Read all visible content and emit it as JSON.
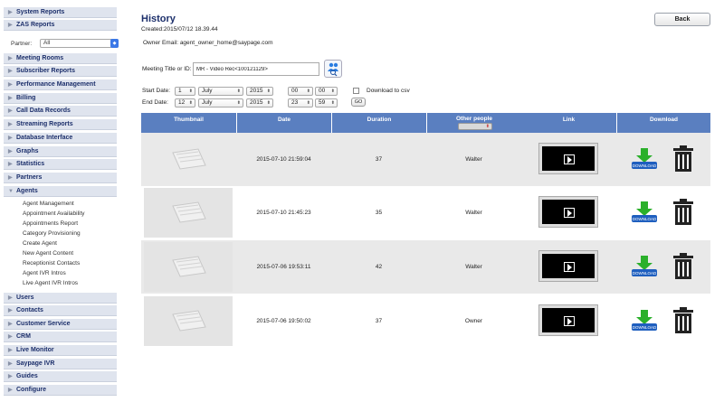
{
  "sidebar": {
    "partner_label": "Partner:",
    "partner_value": "All",
    "items": [
      {
        "label": "System Reports"
      },
      {
        "label": "ZAS Reports"
      },
      {
        "label": "Meeting Rooms"
      },
      {
        "label": "Subscriber Reports"
      },
      {
        "label": "Performance Management"
      },
      {
        "label": "Billing"
      },
      {
        "label": "Call Data Records"
      },
      {
        "label": "Streaming Reports"
      },
      {
        "label": "Database Interface"
      },
      {
        "label": "Graphs"
      },
      {
        "label": "Statistics"
      },
      {
        "label": "Partners"
      },
      {
        "label": "Agents"
      },
      {
        "label": "Users"
      },
      {
        "label": "Contacts"
      },
      {
        "label": "Customer Service"
      },
      {
        "label": "CRM"
      },
      {
        "label": "Live Monitor"
      },
      {
        "label": "Saypage IVR"
      },
      {
        "label": "Guides"
      },
      {
        "label": "Configure"
      }
    ],
    "agents_sub": [
      "Agent Management",
      "Appointment Availability",
      "Appointments Report",
      "Category Provisioning",
      "Create Agent",
      "New Agent Content",
      "Receptionist Contacts",
      "Agent IVR Intros",
      "Live Agent IVR Intros"
    ]
  },
  "header": {
    "title": "History",
    "created": "Created:2015/07/12 18.39.44",
    "owner_email": "Owner Email: agent_owner_home@saypage.com",
    "back_label": "Back"
  },
  "filters": {
    "meeting_label": "Meeting Title or ID:",
    "meeting_value": "MR - Video Rec<100121129>",
    "start_label": "Start Date:",
    "end_label": "End Date:",
    "start": {
      "day": "1",
      "month": "July",
      "year": "2015",
      "hour": "00",
      "minute": "00"
    },
    "end": {
      "day": "12",
      "month": "July",
      "year": "2015",
      "hour": "23",
      "minute": "59"
    },
    "csv_label": "Download to csv",
    "go_label": "GO"
  },
  "table": {
    "headers": [
      "Thumbnail",
      "Date",
      "Duration",
      "Other people",
      "Link",
      "Download"
    ],
    "rows": [
      {
        "date": "2015-07-10 21:59:04",
        "duration": "37",
        "other": "Walter"
      },
      {
        "date": "2015-07-10 21:45:23",
        "duration": "35",
        "other": "Walter"
      },
      {
        "date": "2015-07-06 19:53:11",
        "duration": "42",
        "other": "Walter"
      },
      {
        "date": "2015-07-06 19:50:02",
        "duration": "37",
        "other": "Owner"
      }
    ],
    "download_badge": "DOWNLOAD"
  },
  "colors": {
    "nav_text": "#1c2f6b",
    "header_bg": "#5a7fc0",
    "row_alt": "#e9e9e9",
    "download_green": "#2bb02b",
    "download_blue": "#1f5fbf"
  }
}
